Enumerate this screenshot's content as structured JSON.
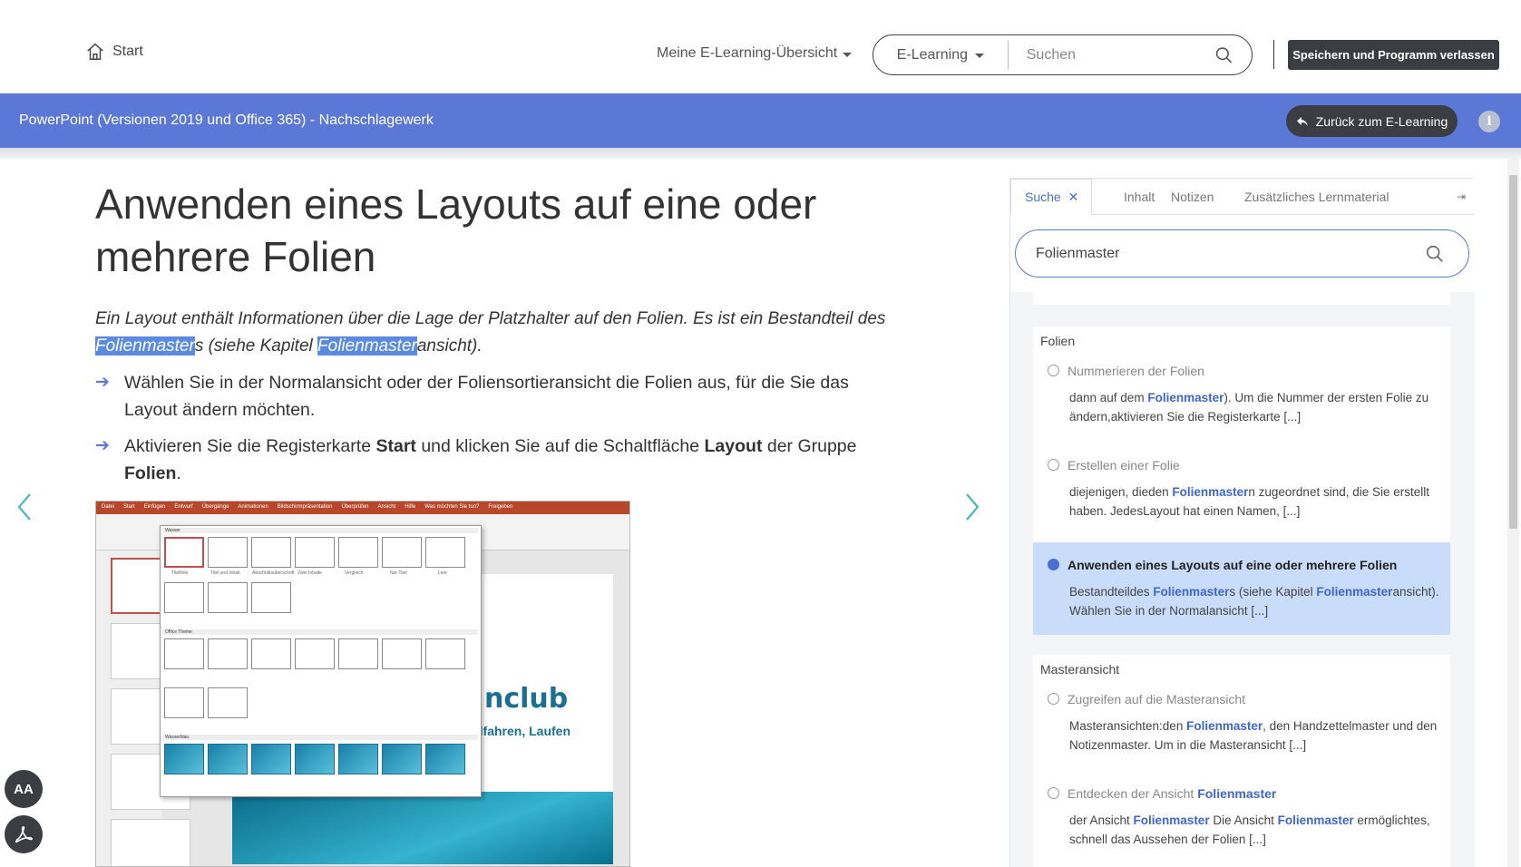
{
  "header": {
    "start_label": "Start",
    "overview_label": "Meine E-Learning-Übersicht",
    "scope_label": "E-Learning",
    "search_placeholder": "Suchen",
    "save_exit_label": "Speichern und Programm verlassen"
  },
  "course_bar": {
    "title": "PowerPoint (Versionen 2019 und Office 365) - Nachschlagewerk",
    "back_label": "Zurück zum E-Learning",
    "info_label": "i"
  },
  "article": {
    "heading": "Anwenden eines Layouts auf eine oder mehrere Folien",
    "intro": {
      "part1": "Ein Layout enthält Informationen über die Lage der Platzhalter auf den Folien. Es ist ein Bestandteil des ",
      "hl1": "Folienmaster",
      "part2": "s (siehe Kapitel ",
      "hl2": "Folienmaster",
      "part3": "ansicht)."
    },
    "step1": "Wählen Sie in der Normalansicht oder der Foliensortieransicht die Folien aus, für die Sie das Layout ändern möchten.",
    "step2": {
      "t1": "Aktivieren Sie die Registerkarte ",
      "b1": "Start",
      "t2": " und klicken Sie auf die Schaltfläche ",
      "b2": "Layout",
      "t3": " der Gruppe ",
      "b3": "Folien",
      "t4": "."
    },
    "screenshot": {
      "tabs": [
        "Datei",
        "Start",
        "Einfügen",
        "Entwurf",
        "Übergänge",
        "Animationen",
        "Bildschirmpräsentation",
        "Überprüfen",
        "Ansicht",
        "Hilfe",
        "Was möchten Sie tun?",
        "Freigeben"
      ],
      "slide_text1": "nclub",
      "slide_text2": "dfahren, Laufen",
      "gallery_sections": [
        "Wasser",
        "Office Theme",
        "Wasserblau"
      ],
      "layout_labels": [
        "Titelfolie",
        "Titel und Inhalt",
        "Abschnittsüberschrift",
        "Zwei Inhalte",
        "Vergleich",
        "Nur Titel",
        "Leer"
      ]
    }
  },
  "panel": {
    "tabs": [
      "Suche",
      "Inhalt",
      "Notizen",
      "Zusätzliches Lernmaterial"
    ],
    "search_value": "Folienmaster",
    "groups": [
      {
        "title": "Folien",
        "items": [
          {
            "title": "Nummerieren der Folien",
            "snip_a": "dann auf dem ",
            "snip_kw": "Folienmaster",
            "snip_b": "). Um die Nummer der ersten Folie zu ändern,aktivieren Sie die Registerkarte [...]"
          },
          {
            "title": "Erstellen einer Folie",
            "snip_a": "diejenigen, dieden ",
            "snip_kw": "Folienmaster",
            "snip_b": "n zugeordnet sind, die Sie erstellt haben. JedesLayout hat einen Namen, [...]"
          },
          {
            "title": "Anwenden eines Layouts auf eine oder mehrere Folien",
            "snip_a": "Bestandteildes ",
            "snip_kw": "Folienmaster",
            "snip_b": "s (siehe Kapitel ",
            "snip_kw2": "Folienmaster",
            "snip_c": "ansicht). Wählen Sie in der Normalansicht [...]"
          }
        ]
      },
      {
        "title": "Masteransicht",
        "items": [
          {
            "title": "Zugreifen auf die Masteransicht",
            "snip_a": "Masteransichten:den ",
            "snip_kw": "Folienmaster",
            "snip_b": ", den Handzettelmaster und den Notizenmaster. Um in die Masteransicht [...]"
          },
          {
            "title_a": "Entdecken der Ansicht ",
            "title_kw": "Folienmaster",
            "snip_a": "der Ansicht ",
            "snip_kw": "Folienmaster",
            "snip_b": " Die Ansicht ",
            "snip_kw2": "Folienmaster",
            "snip_c": " ermöglichtes, schnell das Aussehen der Folien [...]"
          }
        ]
      }
    ]
  },
  "fabs": {
    "font_label": "AA"
  }
}
